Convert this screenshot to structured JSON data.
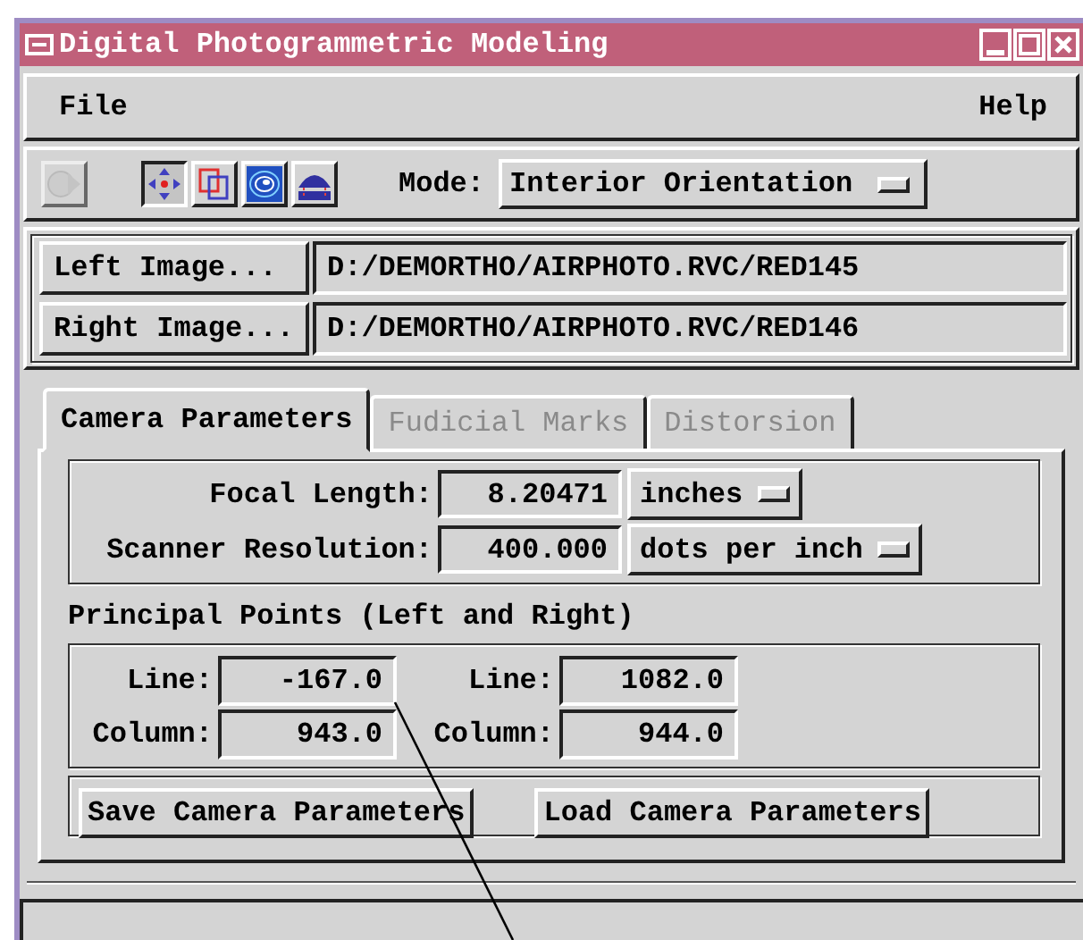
{
  "window": {
    "title": "Digital Photogrammetric Modeling"
  },
  "menu": [
    "File",
    "Help"
  ],
  "toolbar": {
    "tools": [
      {
        "selected": false,
        "disabled": true
      },
      {
        "selected": true,
        "disabled": false
      },
      {
        "selected": false,
        "disabled": false
      },
      {
        "selected": false,
        "disabled": false
      },
      {
        "selected": false,
        "disabled": false
      }
    ],
    "mode_label": "Mode:",
    "mode_value": "Interior Orientation"
  },
  "images": [
    {
      "button": "Left Image...",
      "path": "D:/DEMORTHO/AIRPHOTO.RVC/RED145"
    },
    {
      "button": "Right Image...",
      "path": "D:/DEMORTHO/AIRPHOTO.RVC/RED146"
    }
  ],
  "tabs": [
    {
      "label": "Camera Parameters",
      "selected": true,
      "disabled": false
    },
    {
      "label": "Fudicial Marks",
      "selected": false,
      "disabled": true
    },
    {
      "label": "Distorsion",
      "selected": false,
      "disabled": true
    }
  ],
  "camera": [
    {
      "label": "Focal Length:",
      "value": "8.20471",
      "unit": "inches"
    },
    {
      "label": "Scanner Resolution:",
      "value": "400.000",
      "unit": "dots per inch"
    }
  ],
  "principal_points": {
    "title": "Principal Points (Left and Right)",
    "rows": [
      {
        "cells": [
          {
            "label": "Line:",
            "value": "-167.0"
          },
          {
            "label": "Line:",
            "value": "1082.0"
          }
        ]
      },
      {
        "cells": [
          {
            "label": "Column:",
            "value": "943.0"
          },
          {
            "label": "Column:",
            "value": "944.0"
          }
        ]
      }
    ]
  },
  "buttons": [
    "Save Camera Parameters",
    "Load Camera Parameters"
  ]
}
